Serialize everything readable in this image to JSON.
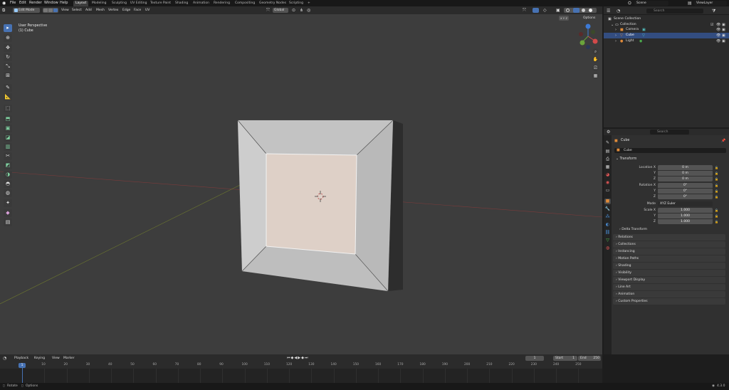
{
  "menus": [
    "File",
    "Edit",
    "Render",
    "Window",
    "Help"
  ],
  "workspaces": [
    "Layout",
    "Modeling",
    "Sculpting",
    "UV Editing",
    "Texture Paint",
    "Shading",
    "Animation",
    "Rendering",
    "Compositing",
    "Geometry Nodes",
    "Scripting"
  ],
  "workspace_add": "+",
  "scene": "Scene",
  "view_layer": "ViewLayer",
  "viewport_header": {
    "mode": "Edit Mode",
    "menus": [
      "View",
      "Select",
      "Add",
      "Mesh",
      "Vertex",
      "Edge",
      "Face",
      "UV"
    ],
    "orientation": "Global",
    "options": "Options",
    "xyz": "X Y Z"
  },
  "viewport": {
    "perspective": "User Perspective",
    "object": "(1) Cube"
  },
  "outliner": {
    "search_placeholder": "Search",
    "rows": [
      {
        "label": "Scene Collection",
        "indent": 0
      },
      {
        "label": "Collection",
        "indent": 1
      },
      {
        "label": "Camera",
        "indent": 2
      },
      {
        "label": "Cube",
        "indent": 2
      },
      {
        "label": "Light",
        "indent": 2
      }
    ]
  },
  "properties": {
    "search_placeholder": "Search",
    "object_name": "Cube",
    "object_field": "Cube",
    "transform_title": "Transform",
    "location_label": "Location X",
    "y_label": "Y",
    "z_label": "Z",
    "rotation_label": "Rotation X",
    "mode_label": "Mode",
    "scale_label": "Scale X",
    "location": [
      "0 m",
      "0 m",
      "0 m"
    ],
    "rotation": [
      "0°",
      "0°",
      "0°"
    ],
    "mode": "XYZ Euler",
    "scale": [
      "1.000",
      "1.000",
      "1.000"
    ],
    "delta": "Delta Transform",
    "panels": [
      "Relations",
      "Collections",
      "Instancing",
      "Motion Paths",
      "Shading",
      "Visibility",
      "Viewport Display",
      "Line Art",
      "Animation",
      "Custom Properties"
    ]
  },
  "timeline": {
    "menus": [
      "Playback",
      "Keying",
      "View",
      "Marker"
    ],
    "current_frame": "1",
    "start_label": "Start",
    "start": "1",
    "end_label": "End",
    "end": "250",
    "current_marker": "1",
    "ticks": [
      "10",
      "20",
      "30",
      "40",
      "50",
      "60",
      "70",
      "80",
      "90",
      "100",
      "110",
      "120",
      "130",
      "140",
      "150",
      "160",
      "170",
      "180",
      "190",
      "200",
      "210",
      "220",
      "230",
      "240",
      "250"
    ]
  },
  "status": {
    "left1": "Rotate",
    "left2": "Options",
    "version": "4.3.0"
  },
  "colors": {
    "accent": "#4772b3",
    "face_fill": "#ded0c7",
    "cube_face": "#c6c6c6"
  }
}
